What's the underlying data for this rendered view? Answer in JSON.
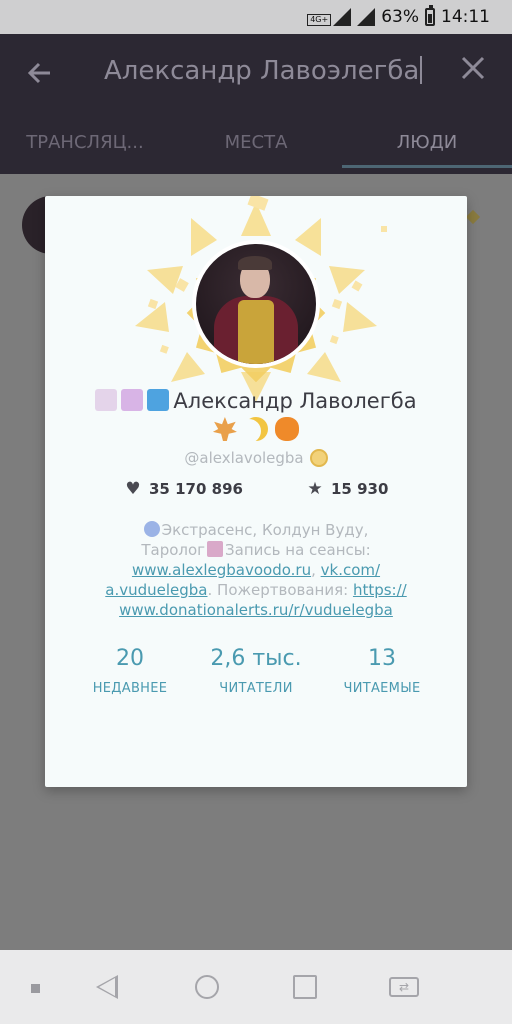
{
  "status_bar": {
    "network": "4G+",
    "battery": "63%",
    "time": "14:11"
  },
  "app_bar": {
    "query": "Александр Лавоэлегба"
  },
  "tabs": [
    {
      "label": "ТРАНСЛЯЦ..."
    },
    {
      "label": "МЕСТА"
    },
    {
      "label": "ЛЮДИ",
      "selected": true
    }
  ],
  "profile": {
    "name": "Александр Лаволегба",
    "handle": "@alexlavolegba",
    "likes": "35 170 896",
    "stars": "15 930",
    "bio": {
      "line1": "Экстрасенс, Колдун Вуду,",
      "line2_pre": "Таролог",
      "line2_post": "Запись на сеансы:",
      "link1": "www.alexlegbavoodo.ru",
      "sep1": ", ",
      "link2a": "vk.com/",
      "link2b": "a.vuduelegba",
      "text3": ". Пожертвования: ",
      "link3a": "https://",
      "link3b": "www.donationalerts.ru/r/vuduelegba"
    },
    "counts": [
      {
        "value": "20",
        "label": "НЕДАВНЕЕ"
      },
      {
        "value": "2,6 тыс.",
        "label": "ЧИТАТЕЛИ"
      },
      {
        "value": "13",
        "label": "ЧИТАЕМЫЕ"
      }
    ]
  },
  "colors": {
    "accent": "#4a9ab0",
    "card_bg": "#f6fbfb",
    "sun": "#f5d77a"
  },
  "icons": [
    "arrow-left-icon",
    "close-icon",
    "heart-icon",
    "star-icon",
    "verified-badge-icon"
  ]
}
